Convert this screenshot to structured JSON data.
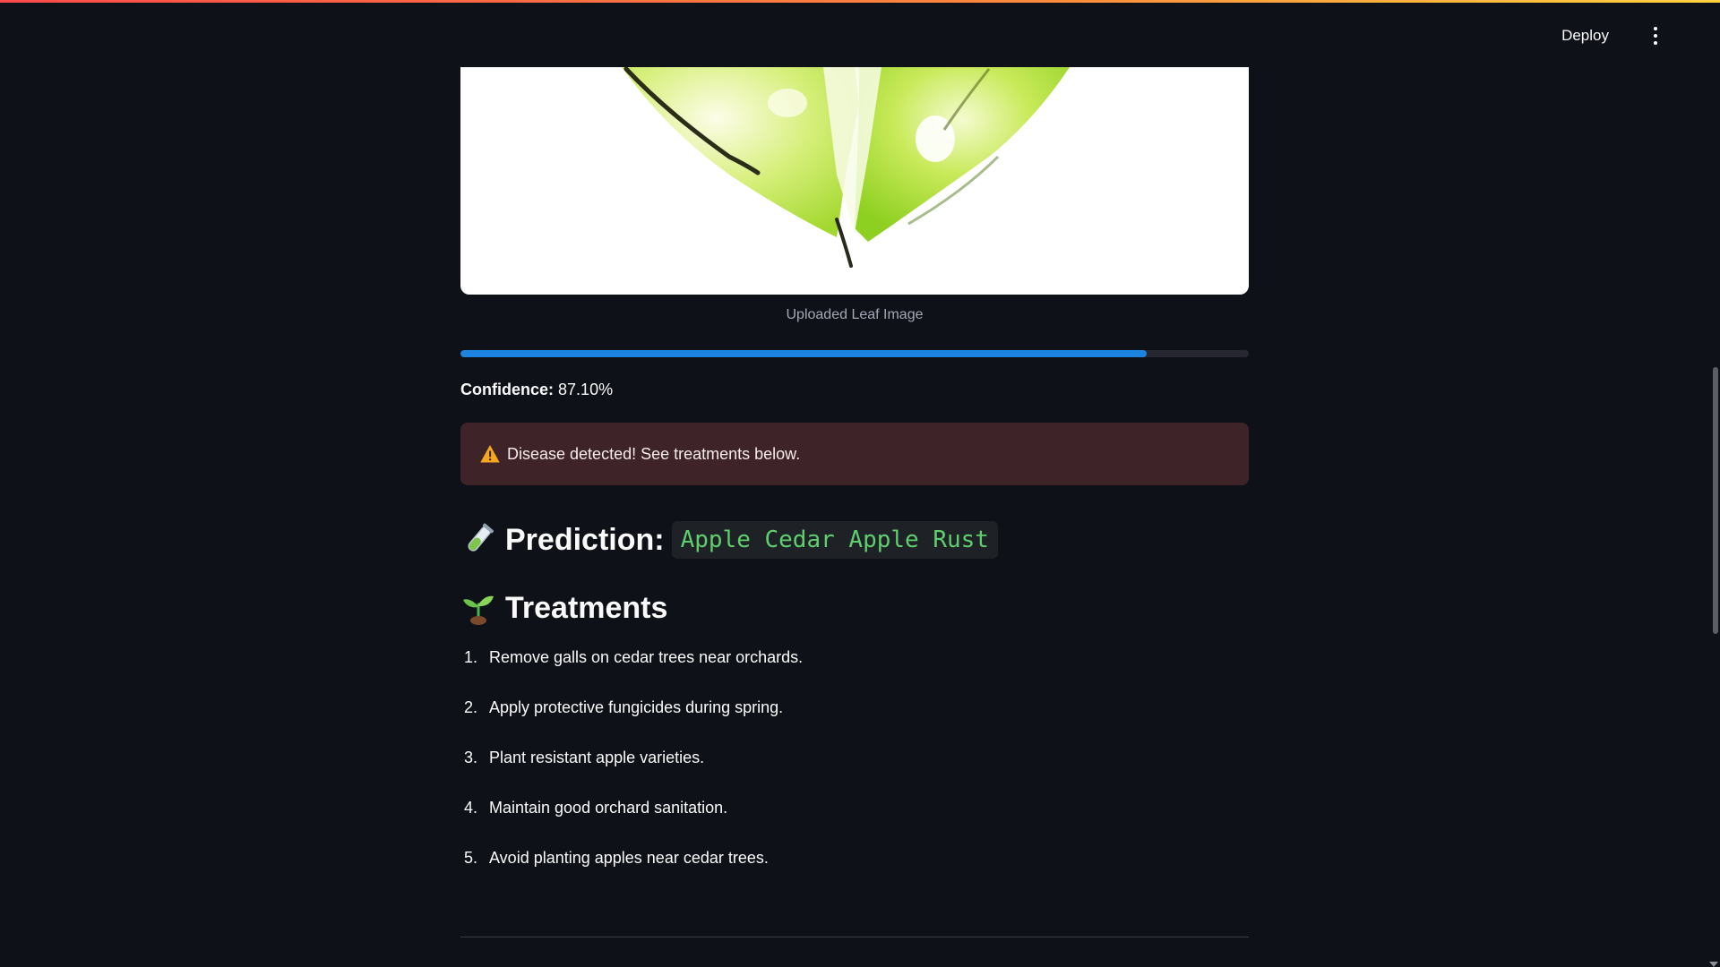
{
  "header": {
    "deploy_label": "Deploy",
    "menu_icon": "kebab-menu-icon"
  },
  "image": {
    "caption": "Uploaded Leaf Image",
    "subject": "leaf-image"
  },
  "progress": {
    "value": 0.871,
    "color": "#1c83e1"
  },
  "confidence": {
    "label": "Confidence:",
    "value": "87.10%"
  },
  "alert": {
    "icon": "warning-icon",
    "text": "Disease detected! See treatments below."
  },
  "prediction": {
    "icon": "test-tube-icon",
    "label": "Prediction:",
    "value": "Apple Cedar Apple Rust"
  },
  "treatments": {
    "icon": "seedling-icon",
    "title": "Treatments",
    "items": [
      {
        "num": "1.",
        "text": "Remove galls on cedar trees near orchards."
      },
      {
        "num": "2.",
        "text": "Apply protective fungicides during spring."
      },
      {
        "num": "3.",
        "text": "Plant resistant apple varieties."
      },
      {
        "num": "4.",
        "text": "Maintain good orchard sanitation."
      },
      {
        "num": "5.",
        "text": "Avoid planting apples near cedar trees."
      }
    ]
  },
  "colors": {
    "background": "#0e1117",
    "alert_bg": "#3e2428",
    "code_text": "#5ecf6c",
    "accent_top": "#ff4b4b"
  }
}
